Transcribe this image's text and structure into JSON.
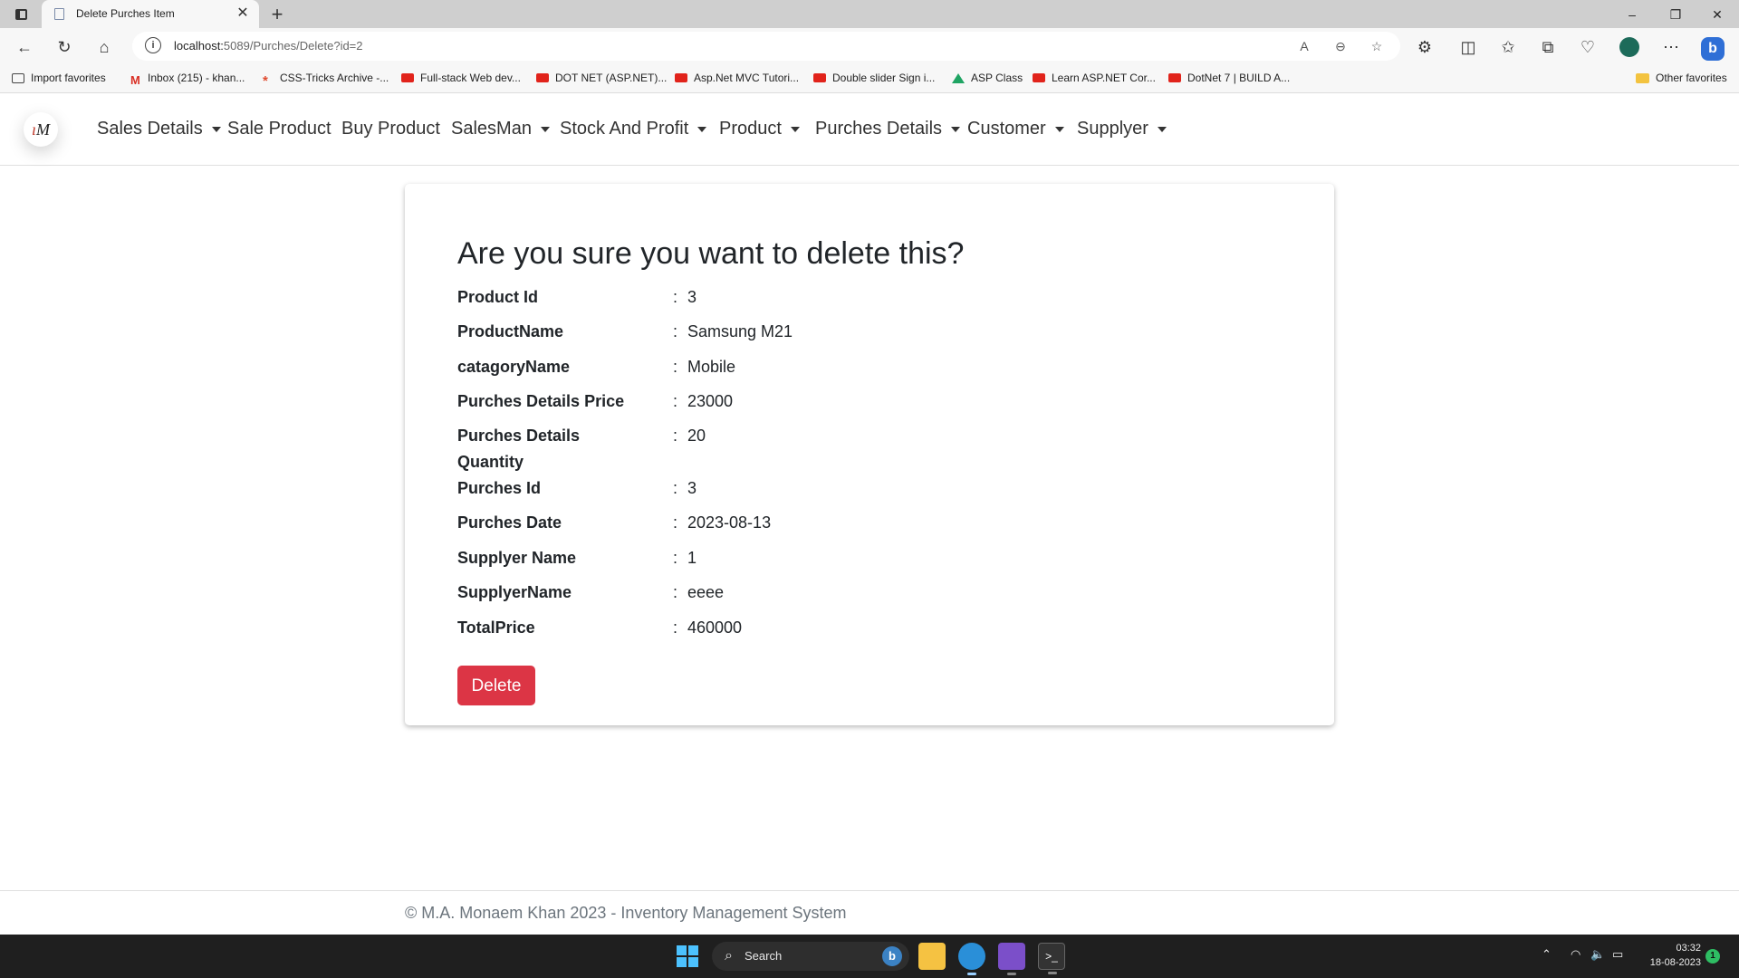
{
  "browser": {
    "tab_title": "Delete Purches Item",
    "address_host": "localhost:",
    "address_rest": "5089/Purches/Delete?id=2",
    "bookmarks": [
      "Import favorites",
      "Inbox (215) - khan...",
      "CSS-Tricks Archive -...",
      "Full-stack Web dev...",
      "DOT NET (ASP.NET)...",
      "Asp.Net MVC Tutori...",
      "Double slider Sign i...",
      "ASP Class",
      "Learn ASP.NET Cor...",
      "DotNet 7 | BUILD A..."
    ],
    "other_favorites": "Other favorites"
  },
  "nav": {
    "logo_text": "M",
    "items": [
      "Sales Details",
      "Sale Product",
      "Buy Product",
      "SalesMan",
      "Stock And Profit",
      "Product",
      "Purches Details",
      "Customer",
      "Supplyer"
    ]
  },
  "card": {
    "title": "Are you sure you want to delete this?",
    "separator": ":",
    "fields": [
      {
        "label": "Product Id",
        "value": "3"
      },
      {
        "label": "ProductName",
        "value": "Samsung M21"
      },
      {
        "label": "catagoryName",
        "value": "Mobile"
      },
      {
        "label": "Purches Details Price",
        "value": "23000"
      },
      {
        "label": "Purches Details Quantity",
        "value": "20"
      },
      {
        "label": "Purches Id",
        "value": "3"
      },
      {
        "label": "Purches Date",
        "value": "2023-08-13"
      },
      {
        "label": "Supplyer Name",
        "value": "1"
      },
      {
        "label": "SupplyerName",
        "value": "eeee"
      },
      {
        "label": "TotalPrice",
        "value": "460000"
      }
    ],
    "delete_label": "Delete"
  },
  "footer": {
    "text": "© M.A. Monaem Khan 2023 - Inventory Management System"
  },
  "taskbar": {
    "search_label": "Search",
    "time": "03:32",
    "date": "18-08-2023",
    "notification_count": "1"
  }
}
